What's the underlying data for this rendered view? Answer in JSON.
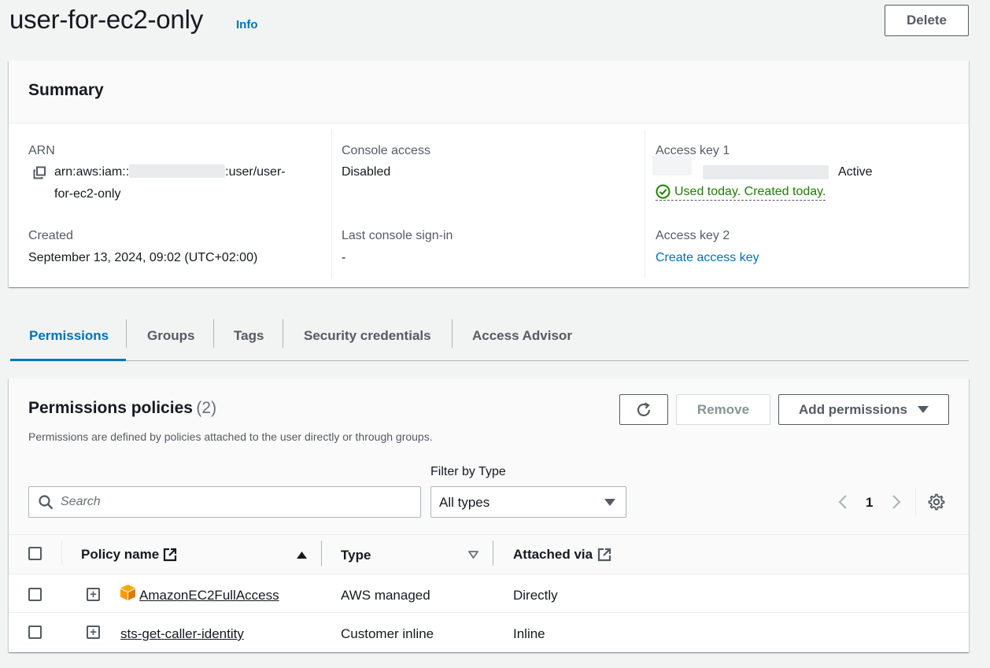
{
  "header": {
    "title": "user-for-ec2-only",
    "info_label": "Info",
    "delete_label": "Delete"
  },
  "summary": {
    "title": "Summary",
    "arn_label": "ARN",
    "arn_prefix": "arn:aws:iam::",
    "arn_suffix": ":user/user-",
    "arn_line2": "for-ec2-only",
    "created_label": "Created",
    "created_value": "September 13, 2024, 09:02 (UTC+02:00)",
    "console_access_label": "Console access",
    "console_access_value": "Disabled",
    "last_signin_label": "Last console sign-in",
    "last_signin_value": "-",
    "access_key1_label": "Access key 1",
    "access_key1_status": "Active",
    "access_key1_usage": "Used today. Created today.",
    "access_key2_label": "Access key 2",
    "access_key2_link": "Create access key"
  },
  "tabs": [
    {
      "label": "Permissions",
      "active": true
    },
    {
      "label": "Groups"
    },
    {
      "label": "Tags"
    },
    {
      "label": "Security credentials"
    },
    {
      "label": "Access Advisor"
    }
  ],
  "permissions": {
    "title": "Permissions policies",
    "count": "(2)",
    "description": "Permissions are defined by policies attached to the user directly or through groups.",
    "remove_label": "Remove",
    "add_label": "Add permissions",
    "search_placeholder": "Search",
    "filter_label": "Filter by Type",
    "filter_value": "All types",
    "page_number": "1",
    "columns": {
      "policy_name": "Policy name",
      "type": "Type",
      "attached_via": "Attached via"
    },
    "rows": [
      {
        "name": "AmazonEC2FullAccess",
        "type": "AWS managed",
        "attached": "Directly"
      },
      {
        "name": "sts-get-caller-identity",
        "type": "Customer inline",
        "attached": "Inline"
      }
    ]
  },
  "colors": {
    "accent": "#0073bb",
    "success": "#1d8102",
    "aws_orange": "#ff9900"
  }
}
